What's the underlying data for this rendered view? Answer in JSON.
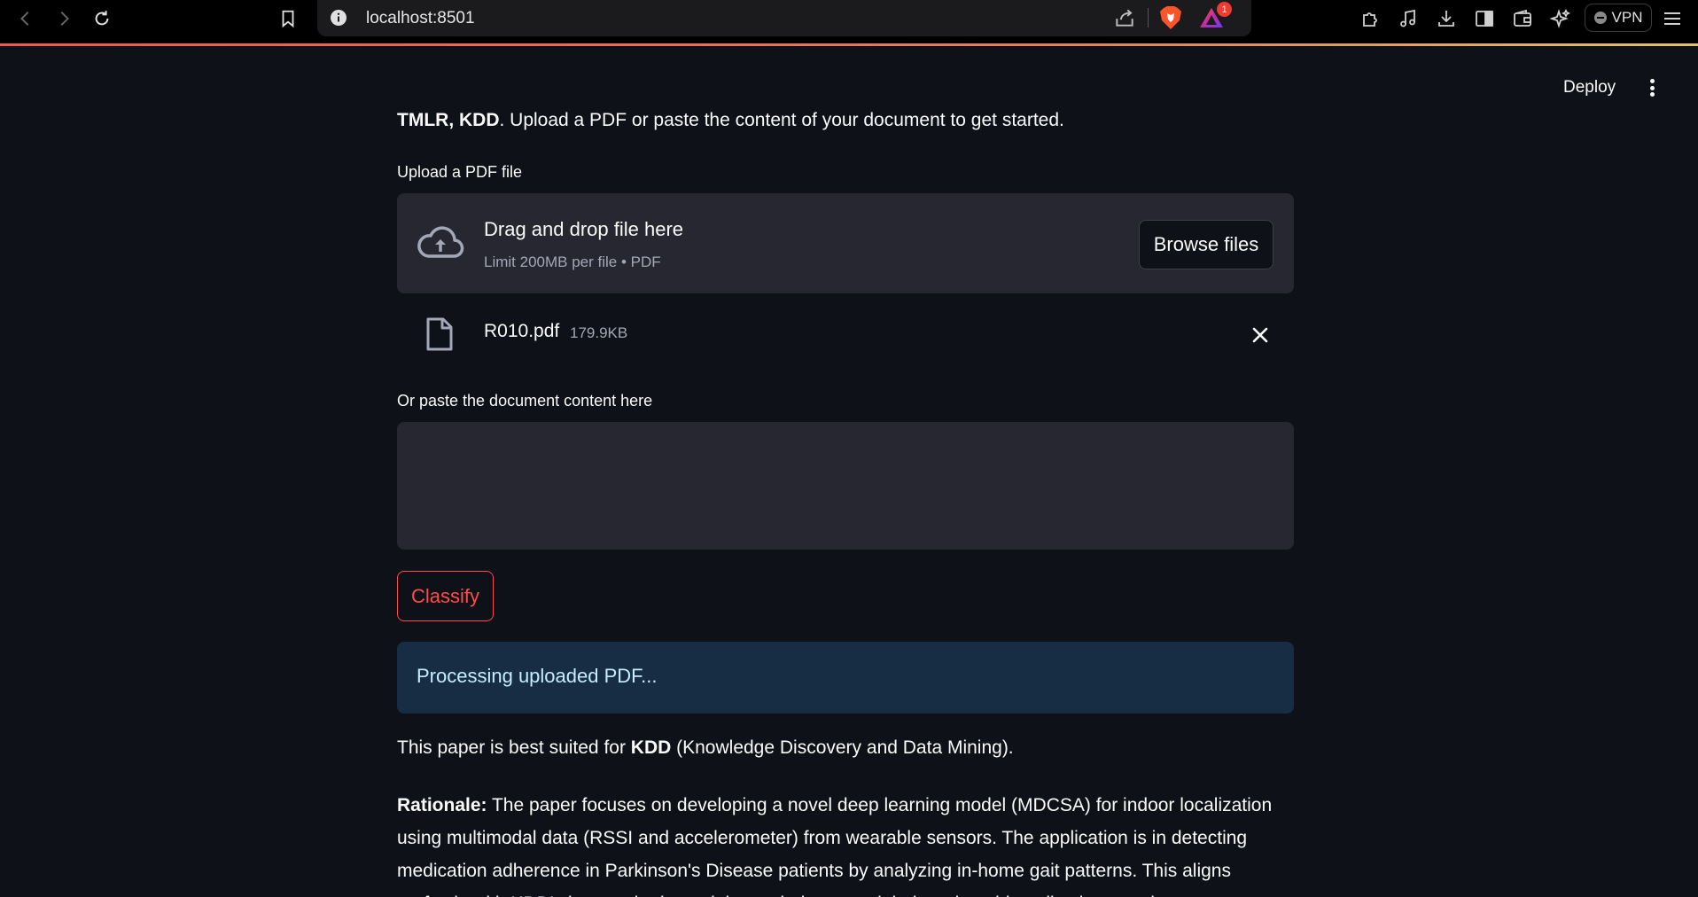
{
  "browser": {
    "url": "localhost:8501",
    "notification_count": "1",
    "vpn_label": "VPN"
  },
  "header": {
    "deploy_label": "Deploy"
  },
  "intro": {
    "bold": "TMLR, KDD",
    "rest": ". Upload a PDF or paste the content of your document to get started."
  },
  "uploader": {
    "label": "Upload a PDF file",
    "title": "Drag and drop file here",
    "subtitle": "Limit 200MB per file • PDF",
    "browse_label": "Browse files"
  },
  "uploaded_file": {
    "name": "R010.pdf",
    "size": "179.9KB"
  },
  "paste": {
    "label": "Or paste the document content here",
    "value": ""
  },
  "classify_label": "Classify",
  "status_message": "Processing uploaded PDF...",
  "result": {
    "prefix": "This paper is best suited for ",
    "venue": "KDD",
    "suffix": " (Knowledge Discovery and Data Mining)."
  },
  "rationale": {
    "label": "Rationale:",
    "text": " The paper focuses on developing a novel deep learning model (MDCSA) for indoor localization using multimodal data (RSSI and accelerometer) from wearable sensors. The application is in detecting medication adherence in Parkinson's Disease patients by analyzing in-home gait patterns. This aligns perfectly with KDD's interest in data mining techniques and their real-world applications, and"
  }
}
